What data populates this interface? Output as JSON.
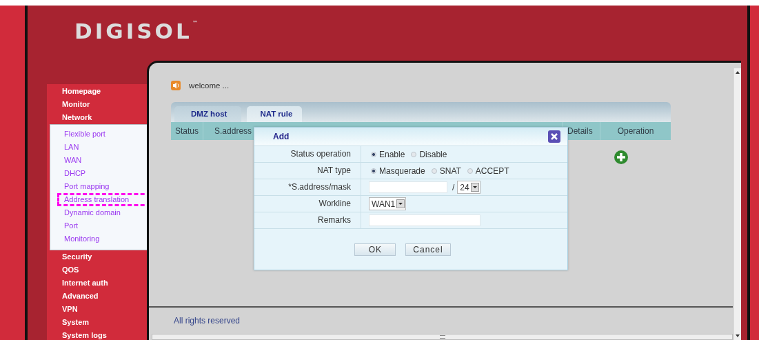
{
  "logo": {
    "text": "DIGISOL",
    "trademark": "™"
  },
  "sidebar": {
    "items": [
      {
        "label": "Homepage"
      },
      {
        "label": "Monitor"
      },
      {
        "label": "Network",
        "children": [
          {
            "label": "Flexible port",
            "highlighted": false
          },
          {
            "label": "LAN",
            "highlighted": false
          },
          {
            "label": "WAN",
            "highlighted": false
          },
          {
            "label": "DHCP",
            "highlighted": false
          },
          {
            "label": "Port mapping",
            "highlighted": false
          },
          {
            "label": "Address translation",
            "highlighted": true
          },
          {
            "label": "Dynamic domain",
            "highlighted": false
          },
          {
            "label": "Port",
            "highlighted": false
          },
          {
            "label": "Monitoring",
            "highlighted": false
          }
        ]
      },
      {
        "label": "Security"
      },
      {
        "label": "QOS"
      },
      {
        "label": "Internet auth"
      },
      {
        "label": "Advanced"
      },
      {
        "label": "VPN"
      },
      {
        "label": "System"
      },
      {
        "label": "System logs"
      }
    ]
  },
  "welcome": "welcome ...",
  "tabs": [
    {
      "label": "DMZ host",
      "selected": false
    },
    {
      "label": "NAT rule",
      "selected": true
    }
  ],
  "table": {
    "columns": [
      "Status",
      "S.address",
      "Details",
      "Operation"
    ]
  },
  "dialog": {
    "title": "Add",
    "rows": [
      {
        "kind": "radio",
        "label": "Status operation",
        "options": [
          {
            "label": "Enable",
            "selected": true
          },
          {
            "label": "Disable",
            "selected": false
          }
        ]
      },
      {
        "kind": "radio",
        "label": "NAT type",
        "options": [
          {
            "label": "Masquerade",
            "selected": true
          },
          {
            "label": "SNAT",
            "selected": false
          },
          {
            "label": "ACCEPT",
            "selected": false
          }
        ]
      },
      {
        "kind": "address",
        "label": "*S.address/mask",
        "separator": "/",
        "mask": "24"
      },
      {
        "kind": "select",
        "label": "Workline",
        "value": "WAN1"
      },
      {
        "kind": "text",
        "label": "Remarks"
      }
    ],
    "buttons": [
      "OK",
      "Cancel"
    ]
  },
  "footer": "All rights reserved"
}
